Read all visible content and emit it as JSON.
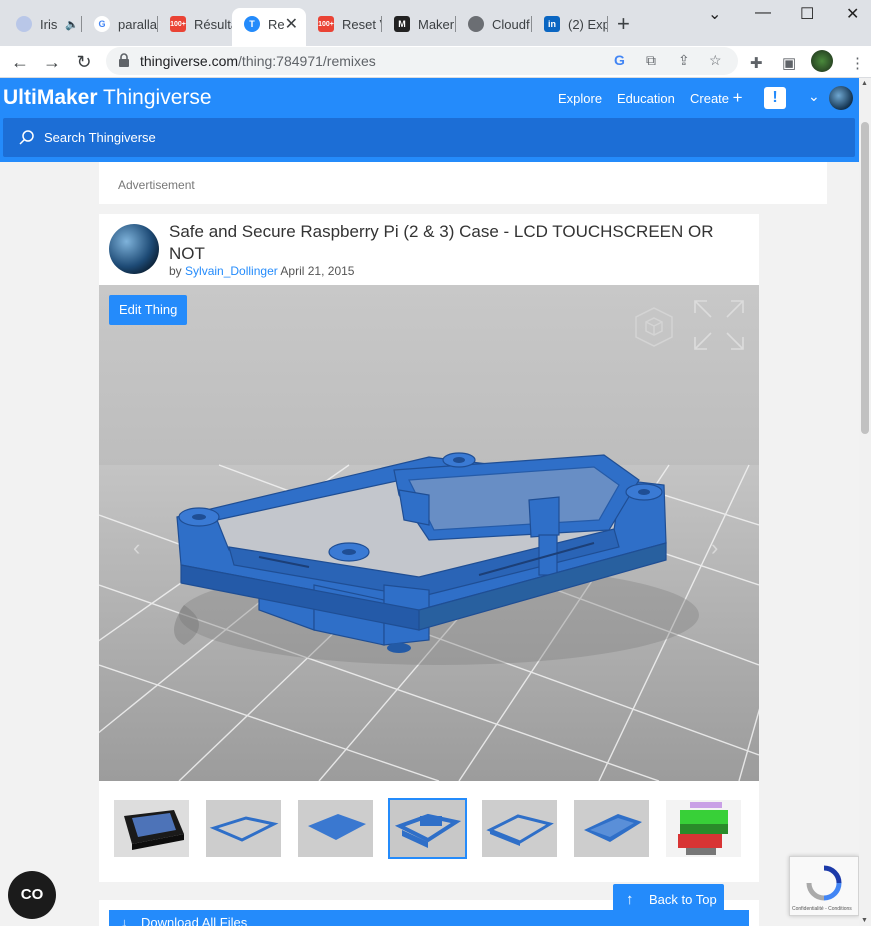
{
  "browser": {
    "tabs": [
      {
        "label": "Iris",
        "audio_icon": "speaker-icon"
      },
      {
        "label": "paralla"
      },
      {
        "label": "Résulta",
        "badge": "100+"
      },
      {
        "label": "Re",
        "active": true
      },
      {
        "label": "Reset V",
        "badge": "100+"
      },
      {
        "label": "Maker"
      },
      {
        "label": "Cloudf"
      },
      {
        "label": "(2) Exp"
      }
    ],
    "url_domain": "thingiverse.com",
    "url_path": "/thing:784971/remixes"
  },
  "site": {
    "logo_brand": "UltiMaker",
    "logo_product": "Thingiverse",
    "nav": {
      "explore": "Explore",
      "education": "Education",
      "create": "Create"
    },
    "alert_label": "!",
    "search_placeholder": "Search Thingiverse"
  },
  "ad_label": "Advertisement",
  "thing": {
    "title": "Safe and Secure Raspberry Pi (2 & 3) Case - LCD TOUCHSCREEN OR NOT",
    "by": "by",
    "author": "Sylvain_Dollinger",
    "date": "April 21, 2015",
    "edit_button": "Edit Thing",
    "selected_thumbnail": 4,
    "thumbnail_count": 7
  },
  "download_button": "Download All Files",
  "back_to_top": "Back to Top",
  "recaptcha_text": "Confidentialité - Conditions",
  "cc_button": "CO",
  "colors": {
    "brand_blue": "#248bfb",
    "search_blue": "#1c6ed6",
    "model_blue": "#2f6fc8"
  }
}
